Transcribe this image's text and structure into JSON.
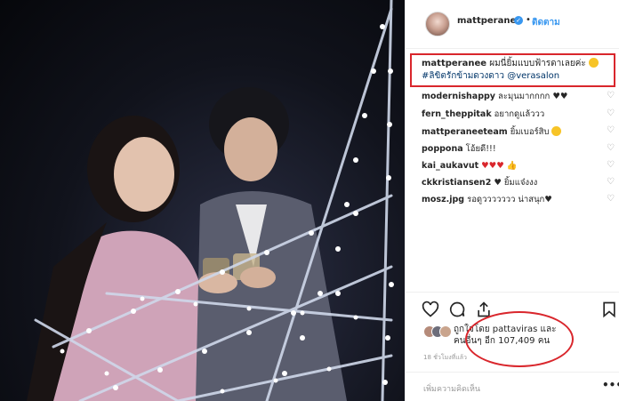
{
  "post": {
    "username": "mattperanee",
    "dot": "•",
    "follow_label": "ติดตาม",
    "caption_user": "mattperanee",
    "caption_text": " ผมนี่ยิ้มแบบฟ้ารดาเลยค่ะ",
    "caption_hashtag": " #ลิขิตรักข้ามดวงดาว",
    "caption_mention": " @verasalon"
  },
  "comments": [
    {
      "user": "modernishappy",
      "text": " ละมุนมากกกก ♥♥"
    },
    {
      "user": "fern_theppitak",
      "text": " อยากดูแล้ววว"
    },
    {
      "user": "mattperaneeteam",
      "text": " ยิ้มเบอร์สิบ"
    },
    {
      "user": "poppona",
      "text": " โอ้ยดี!!!"
    },
    {
      "user": "kai_aukavut",
      "text": " ♥♥♥"
    },
    {
      "user": "ckkristiansen2",
      "text": " ♥ ยิ้มแจ๋งงง"
    },
    {
      "user": "mosz.jpg",
      "text": " รอดูววววววว น่าสนุก♥"
    }
  ],
  "likes": {
    "line1": "ถูกใจโดย pattaviras และ",
    "line2": "คนอื่นๆ อีก 107,409 คน"
  },
  "timestamp": "18 ชั่วโมงที่แล้ว",
  "add_comment_placeholder": "เพิ่มความคิดเห็น",
  "more_label": "•••",
  "icons": [
    "heart-icon",
    "comment-icon",
    "share-icon",
    "bookmark-icon",
    "verified-icon"
  ],
  "colors": {
    "accent": "#3897f0",
    "annotation": "#d9262c",
    "link": "#003569"
  }
}
